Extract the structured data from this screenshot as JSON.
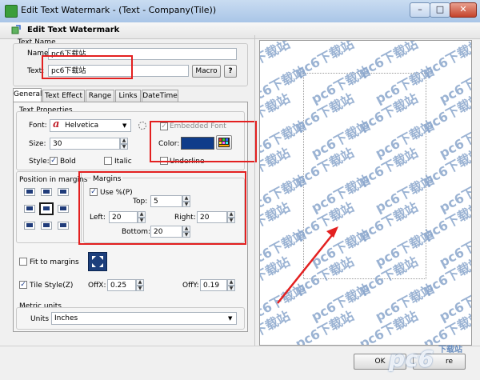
{
  "window": {
    "title": "Edit Text Watermark - (Text - Company(Tile))",
    "min_symbol": "–",
    "max_symbol": "□",
    "close_symbol": "✕"
  },
  "header": {
    "title": "Edit Text Watermark"
  },
  "text_name": {
    "group_label": "Text Name",
    "name_label": "Name:",
    "name_value": "pc6下载站",
    "text_label": "Text:",
    "text_value": "pc6下载站",
    "macro_button": "Macro",
    "help_button": "?"
  },
  "tabs": [
    {
      "label": "General",
      "active": true
    },
    {
      "label": "Text Effect",
      "active": false
    },
    {
      "label": "Range",
      "active": false
    },
    {
      "label": "Links",
      "active": false
    },
    {
      "label": "DateTime",
      "active": false
    }
  ],
  "text_properties": {
    "group_label": "Text Properties",
    "font_label": "Font:",
    "font_value": "Helvetica",
    "embedded_font_label": "Embedded Font",
    "size_label": "Size:",
    "size_value": "30",
    "color_label": "Color:",
    "color_hex": "#0f3c8a",
    "style_label": "Style:",
    "bold_label": "Bold",
    "bold_checked": true,
    "italic_label": "Italic",
    "italic_checked": false,
    "underline_label": "Underline",
    "underline_checked": false
  },
  "position": {
    "group_label": "Position in margins"
  },
  "margins": {
    "group_label": "Margins",
    "use_percent_label": "Use %(P)",
    "use_percent_checked": true,
    "top_label": "Top:",
    "top_value": "5",
    "left_label": "Left:",
    "left_value": "20",
    "right_label": "Right:",
    "right_value": "20",
    "bottom_label": "Bottom:",
    "bottom_value": "20"
  },
  "fit": {
    "fit_to_margins_label": "Fit to margins",
    "fit_checked": false
  },
  "tile": {
    "tile_style_label": "Tile Style(Z)",
    "tile_checked": true,
    "offx_label": "OffX:",
    "offx_value": "0.25",
    "offy_label": "OffY:",
    "offy_value": "0.19"
  },
  "metric": {
    "group_label": "Metric units",
    "units_label": "Units",
    "units_value": "Inches"
  },
  "preview": {
    "watermark_text": "pc6下载站"
  },
  "footer": {
    "ok_button": "OK",
    "cancel_partial": "re",
    "logo_text": "pc6",
    "logo_sub": "下载站"
  },
  "colors": {
    "accent": "#1a3c8a",
    "highlight_red": "#e32020"
  }
}
